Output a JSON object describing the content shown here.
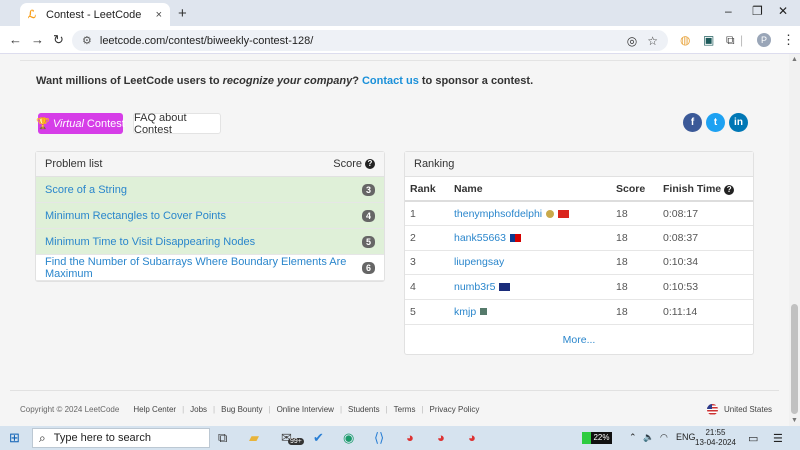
{
  "browser": {
    "tab_title": "Contest - LeetCode",
    "tab_close": "×",
    "new_tab": "+",
    "window_controls": [
      "–",
      "❐",
      "✕"
    ],
    "url": "leetcode.com/contest/biweekly-contest-128/",
    "profile_initial": "P"
  },
  "sponsor": {
    "lead": "Want millions of LeetCode users to ",
    "emphasis": "recognize your company",
    "mid": "? ",
    "link": "Contact us",
    "tail": " to sponsor a contest."
  },
  "buttons": {
    "virtual_prefix": "🏆",
    "virtual_em": "Virtual",
    "virtual_label": "Contest",
    "faq_label": "FAQ about Contest"
  },
  "social": [
    {
      "icon": "facebook-icon",
      "glyph": "f",
      "color": "#3b5998"
    },
    {
      "icon": "twitter-icon",
      "glyph": "t",
      "color": "#1da1f2"
    },
    {
      "icon": "linkedin-icon",
      "glyph": "in",
      "color": "#0077b5"
    }
  ],
  "problems": {
    "header": "Problem list",
    "score_header": "Score",
    "items": [
      {
        "label": "Score of a String",
        "score": "3",
        "solved": true
      },
      {
        "label": "Minimum Rectangles to Cover Points",
        "score": "4",
        "solved": true
      },
      {
        "label": "Minimum Time to Visit Disappearing Nodes",
        "score": "5",
        "solved": true
      },
      {
        "label": "Find the Number of Subarrays Where Boundary Elements Are Maximum",
        "score": "6",
        "solved": false
      }
    ]
  },
  "ranking": {
    "header": "Ranking",
    "columns": [
      "Rank",
      "Name",
      "Score",
      "Finish Time"
    ],
    "rows": [
      {
        "rank": "1",
        "name": "thenymphsofdelphi",
        "score": "18",
        "time": "0:08:17",
        "flags": [
          "badge",
          "vn"
        ]
      },
      {
        "rank": "2",
        "name": "hank55663",
        "score": "18",
        "time": "0:08:37",
        "flags": [
          "tw"
        ]
      },
      {
        "rank": "3",
        "name": "liupengsay",
        "score": "18",
        "time": "0:10:34",
        "flags": []
      },
      {
        "rank": "4",
        "name": "numb3r5",
        "score": "18",
        "time": "0:10:53",
        "flags": [
          "au"
        ]
      },
      {
        "rank": "5",
        "name": "kmjp",
        "score": "18",
        "time": "0:11:14",
        "flags": [
          "cube"
        ]
      }
    ],
    "more": "More..."
  },
  "footer": {
    "copyright": "Copyright © 2024 LeetCode",
    "links": [
      "Help Center",
      "Jobs",
      "Bug Bounty",
      "Online Interview",
      "Students",
      "Terms",
      "Privacy Policy"
    ],
    "region": "United States"
  },
  "taskbar": {
    "search_placeholder": "Type here to search",
    "battery": "22%",
    "lang": "ENG",
    "time": "21:55",
    "date": "13-04-2024",
    "notif_badge": "99+"
  }
}
